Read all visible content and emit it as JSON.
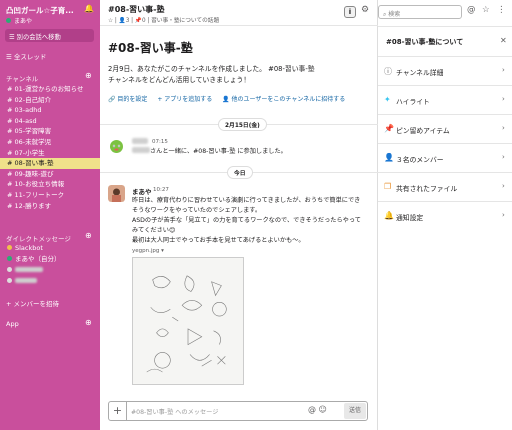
{
  "colors": {
    "sidebar": "#c94f9c",
    "active_channel": "#f0e18a",
    "link": "#1264a3",
    "online": "#2bac76"
  },
  "sidebar": {
    "workspace": "凸凹ガール☆子育...",
    "user": "まあや",
    "jump": "別の会話へ移動",
    "threads": "全スレッド",
    "channels_heading": "チャンネル",
    "channels": [
      {
        "label": "# 01-運営からのお知らせ",
        "active": false
      },
      {
        "label": "# 02-自己紹介",
        "active": false
      },
      {
        "label": "# 03-adhd",
        "active": false
      },
      {
        "label": "# 04-asd",
        "active": false
      },
      {
        "label": "# 05-学習障害",
        "active": false
      },
      {
        "label": "# 06-未就学児",
        "active": false
      },
      {
        "label": "# 07-小学生",
        "active": false
      },
      {
        "label": "# 08-習い事-塾",
        "active": true
      },
      {
        "label": "# 09-趣味-遊び",
        "active": false
      },
      {
        "label": "# 10-お役立ち情報",
        "active": false
      },
      {
        "label": "# 11-フリートーク",
        "active": false
      },
      {
        "label": "# 12-勝ります",
        "active": false
      }
    ],
    "dm_heading": "ダイレクトメッセージ",
    "dms": [
      {
        "label": "Slackbot",
        "color": "#f0c24a"
      },
      {
        "label": "まあや（自分）",
        "color": "#2bac76"
      }
    ],
    "invite": "+ メンバーを招待",
    "app": "App"
  },
  "header": {
    "title": "#08-習い事-塾",
    "meta": "☆ | 👤3 | 📌0 | 習い事・塾についての話題"
  },
  "toolbar": {
    "search_placeholder": "検索"
  },
  "intro": {
    "title": "#08-習い事-塾",
    "line1": "2月9日、あなたがこのチャンネルを作成しました。 #08-習い事-塾",
    "line2": "チャンネルをどんどん活用していきましょう！",
    "actions": [
      "🔗 目的を設定",
      "+ アプリを追加する",
      "👤 他のユーザーをこのチャンネルに招待する"
    ]
  },
  "date1": "2月15日(金)",
  "join_msg": {
    "time": "07:15",
    "text": "さんと一緒に、#08-習い事-塾 に参加しました。"
  },
  "date2": "今日",
  "post": {
    "name": "まあや",
    "time": "10:27",
    "lines": [
      "昨日は、療育代わりに習わせている演劇に行ってきましたが、おうちで簡単にでき",
      "そうなワークをやっていたのでシェアします。",
      "ASDの子が苦手な「見立て」の力を育てるワークなので、できそうだったらやって",
      "みてください😊",
      "最初は大人同士でやってお手本を見せてあげるとよいかも〜。"
    ],
    "file": "yegpn.jpg ▾"
  },
  "composer": {
    "placeholder": "#08-習い事-塾 へのメッセージ",
    "send": "送信"
  },
  "panel": {
    "title": "#08-習い事-塾について",
    "rows": [
      {
        "icon": "ⓘ",
        "label": "チャンネル詳細",
        "color": "#616061"
      },
      {
        "icon": "✦",
        "label": "ハイライト",
        "color": "#36c5f0"
      },
      {
        "icon": "📌",
        "label": "ピン留めアイテム",
        "color": "#e01e5a"
      },
      {
        "icon": "👤",
        "label": "３名のメンバー",
        "color": "#2bac76"
      },
      {
        "icon": "❐",
        "label": "共有されたファイル",
        "color": "#e8912d"
      },
      {
        "icon": "🔔",
        "label": "通知設定",
        "color": "#e01e5a"
      }
    ]
  }
}
